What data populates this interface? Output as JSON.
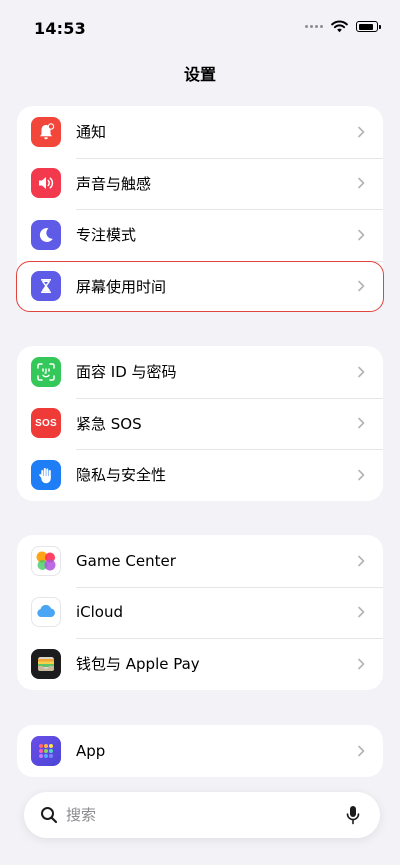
{
  "status_bar": {
    "time": "14:53",
    "battery_level": 0.85
  },
  "header": {
    "title": "设置"
  },
  "groups": [
    {
      "items": [
        {
          "label": "通知",
          "icon": "bell-badge-icon",
          "color": "#f2463a"
        },
        {
          "label": "声音与触感",
          "icon": "speaker-icon",
          "color": "#f2394d"
        },
        {
          "label": "专注模式",
          "icon": "moon-icon",
          "color": "#5e5ce6"
        },
        {
          "label": "屏幕使用时间",
          "icon": "hourglass-icon",
          "color": "#5e5ce6"
        }
      ]
    },
    {
      "items": [
        {
          "label": "面容 ID 与密码",
          "icon": "face-id-icon",
          "color": "#34c759"
        },
        {
          "label": "紧急 SOS",
          "icon": "sos-icon",
          "color": "#ef3b37",
          "icon_text": "SOS"
        },
        {
          "label": "隐私与安全性",
          "icon": "hand-icon",
          "color": "#1f7ef5"
        }
      ]
    },
    {
      "items": [
        {
          "label": "Game Center",
          "icon": "game-center-icon",
          "color": "#ffffff"
        },
        {
          "label": "iCloud",
          "icon": "cloud-icon",
          "color": "#ffffff"
        },
        {
          "label": "钱包与 Apple Pay",
          "icon": "wallet-icon",
          "color": "#1c1c1e"
        }
      ]
    },
    {
      "items": [
        {
          "label": "App",
          "icon": "app-grid-icon",
          "color": "#5b4ce0"
        }
      ]
    }
  ],
  "highlight_color": "#e2453c",
  "search": {
    "placeholder": "搜索"
  }
}
